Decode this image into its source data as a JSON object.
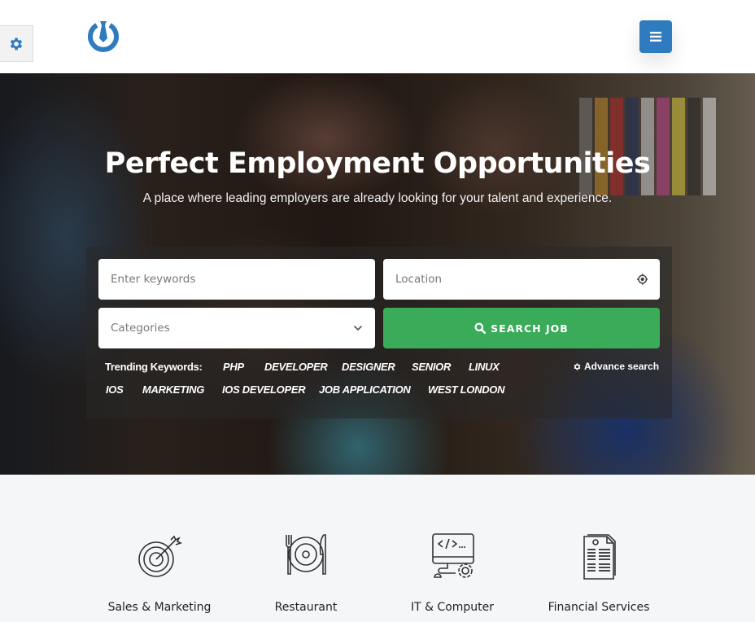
{
  "header": {
    "settings_icon": "gear-icon",
    "logo_icon": "power-tie-logo-icon",
    "menu_icon": "hamburger-icon",
    "brand_color": "#2e7cbf"
  },
  "hero": {
    "title": "Perfect Employment Opportunities",
    "subtitle": "A place where leading employers are already looking for your talent and experience.",
    "search": {
      "keywords_placeholder": "Enter keywords",
      "location_placeholder": "Location",
      "location_icon": "crosshair-icon",
      "category_selected": "Categories",
      "category_icon": "chevron-down-icon",
      "search_button_label": "SEARCH JOB",
      "search_button_icon": "search-icon",
      "search_button_color": "#3aab58"
    },
    "trending": {
      "label": "Trending Keywords:",
      "keywords": [
        "PHP",
        "DEVELOPER",
        "DESIGNER",
        "SENIOR",
        "LINUX",
        "IOS",
        "MARKETING",
        "IOS DEVELOPER",
        "JOB APPLICATION",
        "WEST LONDON"
      ]
    },
    "advance_search": {
      "label": "Advance search",
      "icon": "gear-icon"
    }
  },
  "categories": [
    {
      "label": "Sales & Marketing",
      "icon": "target-arrow-icon"
    },
    {
      "label": "Restaurant",
      "icon": "plate-fork-knife-icon"
    },
    {
      "label": "IT & Computer",
      "icon": "monitor-code-gear-icon"
    },
    {
      "label": "Financial Services",
      "icon": "financial-document-icon"
    }
  ]
}
